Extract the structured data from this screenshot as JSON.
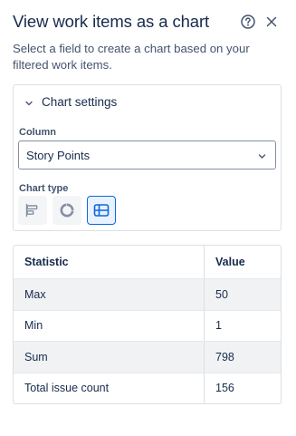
{
  "panel": {
    "title": "View work items as a chart",
    "description": "Select a field to create a chart based on your filtered work items."
  },
  "icons": {
    "help": "question-circle-icon",
    "close": "close-icon",
    "collapse": "chevron-down-icon",
    "select_dropdown": "chevron-down-icon",
    "bar_chart": "bar-chart-icon",
    "donut_chart": "donut-chart-icon",
    "table": "table-icon"
  },
  "settings": {
    "title": "Chart settings",
    "expanded": true,
    "column_label": "Column",
    "column_value": "Story Points",
    "chart_type_label": "Chart type",
    "chart_types": [
      "bar",
      "donut",
      "table"
    ],
    "selected_chart_type": "table"
  },
  "stats": {
    "headers": [
      "Statistic",
      "Value"
    ],
    "rows": [
      {
        "statistic": "Max",
        "value": "50"
      },
      {
        "statistic": "Min",
        "value": "1"
      },
      {
        "statistic": "Sum",
        "value": "798"
      },
      {
        "statistic": "Total issue count",
        "value": "156"
      }
    ]
  },
  "colors": {
    "text": "#172b4d",
    "subtle_text": "#44546f",
    "selected_blue": "#0c66e4",
    "selected_bg": "#e9f2ff",
    "row_shade": "#f1f2f4"
  }
}
